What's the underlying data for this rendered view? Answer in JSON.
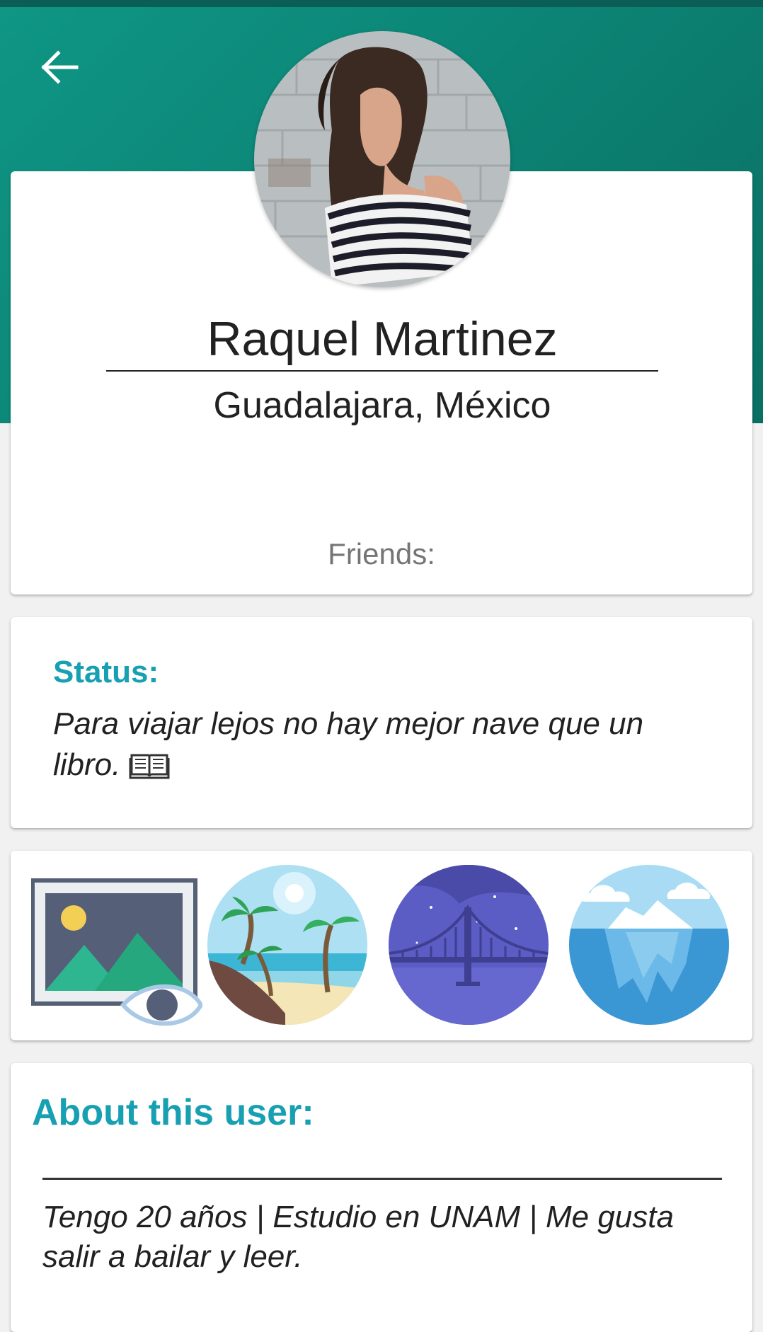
{
  "profile": {
    "name": "Raquel Martinez",
    "location": "Guadalajara, México",
    "friends_label": "Friends:"
  },
  "status": {
    "title": "Status:",
    "text": "Para viajar lejos no hay mejor nave que un libro."
  },
  "gallery": {
    "items": [
      {
        "icon": "image-preview-icon"
      },
      {
        "icon": "beach-palms-icon"
      },
      {
        "icon": "night-bridge-icon"
      },
      {
        "icon": "iceberg-icon"
      }
    ]
  },
  "about": {
    "title": "About this user:",
    "text": "Tengo 20 años | Estudio en UNAM | Me gusta salir a bailar y leer."
  },
  "colors": {
    "header": "#0c8576",
    "accent": "#17a0b2"
  }
}
